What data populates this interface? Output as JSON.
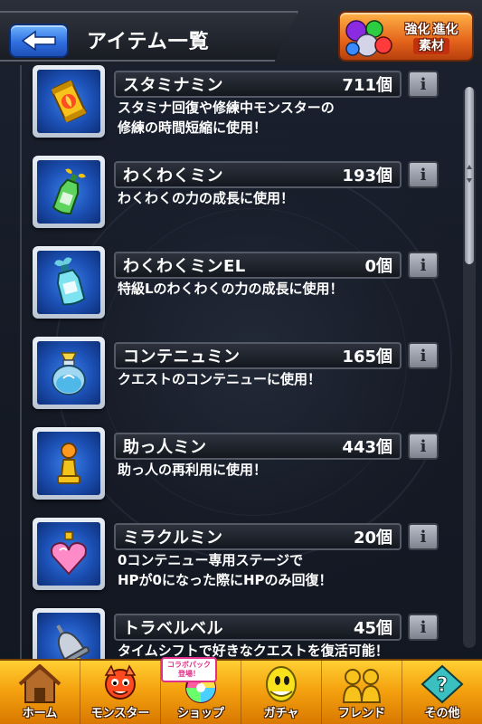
{
  "header": {
    "title": "アイテム一覧",
    "evo_button": {
      "line1a": "強化",
      "line1b": "進化",
      "line2": "素材"
    }
  },
  "items": [
    {
      "name": "スタミナミン",
      "count": "711個",
      "desc1": "スタミナ回復や修練中モンスターの",
      "desc2": "修練の時間短縮に使用！",
      "icon": "can-icon"
    },
    {
      "name": "わくわくミン",
      "count": "193個",
      "desc1": "わくわくの力の成長に使用！",
      "desc2": "",
      "icon": "green-bottle-icon"
    },
    {
      "name": "わくわくミンEL",
      "count": "0個",
      "desc1": "特級Lのわくわくの力の成長に使用！",
      "desc2": "",
      "icon": "el-bottle-icon"
    },
    {
      "name": "コンテニュミン",
      "count": "165個",
      "desc1": "クエストのコンテニューに使用！",
      "desc2": "",
      "icon": "potion-jar-icon"
    },
    {
      "name": "助っ人ミン",
      "count": "443個",
      "desc1": "助っ人の再利用に使用！",
      "desc2": "",
      "icon": "pawn-icon"
    },
    {
      "name": "ミラクルミン",
      "count": "20個",
      "desc1": "0コンテニュー専用ステージで",
      "desc2": "HPが0になった際にHPのみ回復！",
      "icon": "heart-bottle-icon"
    },
    {
      "name": "トラベルベル",
      "count": "45個",
      "desc1": "タイムシフトで好きなクエストを復活可能！",
      "desc2": "",
      "icon": "bell-icon"
    }
  ],
  "info_button_label": "i",
  "nav": {
    "badge_line1": "コラボパック",
    "badge_line2": "登場！",
    "items": [
      {
        "label": "ホーム",
        "icon": "home-icon"
      },
      {
        "label": "モンスター",
        "icon": "monster-icon"
      },
      {
        "label": "ショップ",
        "icon": "shop-icon"
      },
      {
        "label": "ガチャ",
        "icon": "gacha-icon"
      },
      {
        "label": "フレンド",
        "icon": "friend-icon"
      },
      {
        "label": "その他",
        "icon": "other-icon"
      }
    ]
  },
  "colors": {
    "accent_blue": "#2f6fe0",
    "nav_orange": "#f5a310",
    "evo_orange": "#e4641b"
  }
}
